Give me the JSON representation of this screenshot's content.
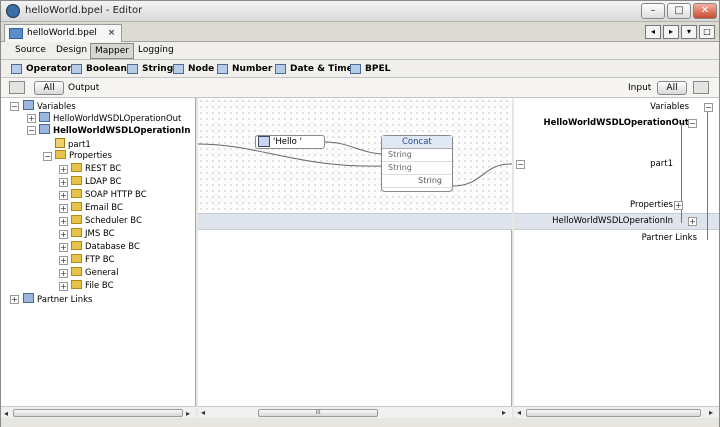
{
  "window": {
    "title": "helloWorld.bpel - Editor"
  },
  "doc_tab": {
    "label": "helloWorld.bpel",
    "close": "×"
  },
  "view_tabs": [
    {
      "label": "Source"
    },
    {
      "label": "Design"
    },
    {
      "label": "Mapper",
      "selected": true
    },
    {
      "label": "Logging"
    }
  ],
  "palette": [
    {
      "label": "Operator"
    },
    {
      "label": "Boolean"
    },
    {
      "label": "String"
    },
    {
      "label": "Node"
    },
    {
      "label": "Number"
    },
    {
      "label": "Date & Time"
    },
    {
      "label": "BPEL"
    }
  ],
  "filter": {
    "left_all": "All",
    "left_output": "Output",
    "right_input": "Input",
    "right_all": "All"
  },
  "left_tree": {
    "variables": "Variables",
    "out_var": "HelloWorldWSDLOperationOut",
    "in_var": "HelloWorldWSDLOperationIn",
    "part1": "part1",
    "properties": "Properties",
    "props": [
      "REST BC",
      "LDAP BC",
      "SOAP HTTP BC",
      "Email BC",
      "Scheduler BC",
      "JMS BC",
      "Database BC",
      "FTP BC",
      "General",
      "File BC"
    ],
    "partner_links": "Partner Links"
  },
  "mapper": {
    "literal": "'Hello '",
    "function": {
      "name": "Concat",
      "inputs": [
        "String",
        "String"
      ],
      "output": "String"
    }
  },
  "right_tree": {
    "variables": "Variables",
    "out_var": "HelloWorldWSDLOperationOut",
    "part1": "part1",
    "properties": "Properties",
    "in_var": "HelloWorldWSDLOperationIn",
    "partner_links": "Partner Links"
  },
  "scroll": {
    "grip": "III"
  }
}
